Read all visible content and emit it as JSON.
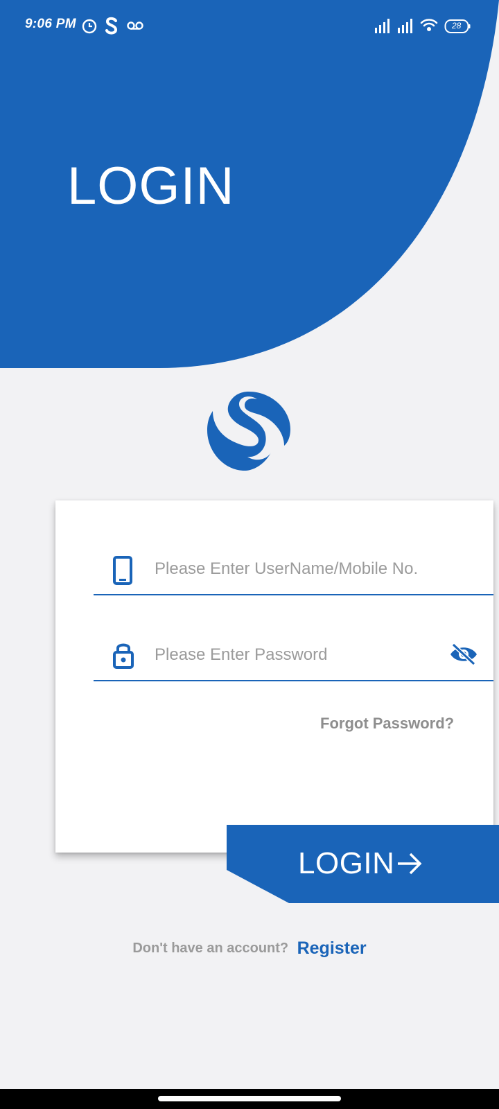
{
  "status_bar": {
    "time": "9:06 PM",
    "battery": "28",
    "icons": [
      "clock-icon",
      "s-app-icon",
      "voicemail-icon",
      "signal-icon",
      "signal-icon",
      "wifi-icon",
      "battery-icon"
    ]
  },
  "header": {
    "title": "LOGIN"
  },
  "login_form": {
    "username": {
      "placeholder": "Please Enter UserName/Mobile No.",
      "value": "",
      "icon": "phone-icon"
    },
    "password": {
      "placeholder": "Please Enter Password",
      "value": "",
      "icon": "lock-icon",
      "toggle_icon": "eye-off-icon"
    },
    "forgot_password_label": "Forgot Password?",
    "submit_label": "LOGIN",
    "submit_icon": "arrow-right-icon"
  },
  "register": {
    "prompt": "Don't have an account?",
    "link_label": "Register"
  },
  "colors": {
    "primary": "#1a64b8",
    "background": "#f2f2f4",
    "card": "#ffffff",
    "muted_text": "#9a9a9a"
  }
}
